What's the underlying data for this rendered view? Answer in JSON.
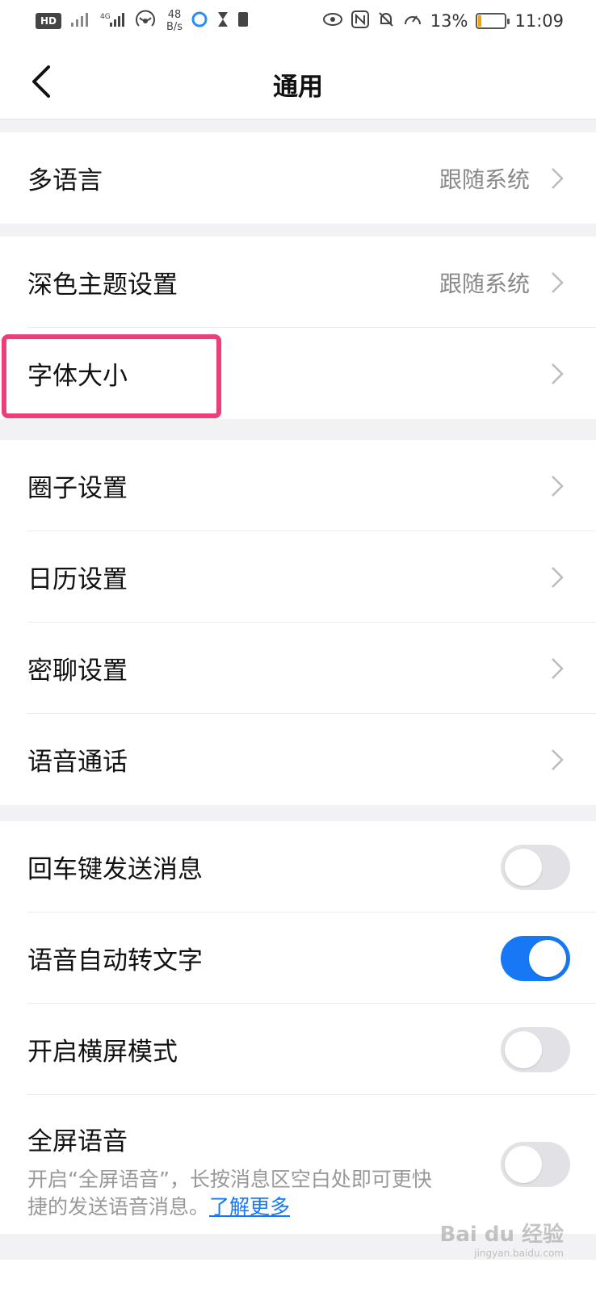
{
  "status_bar": {
    "hd_label": "HD",
    "network_speed": "48\nB/s",
    "battery_percent": "13%",
    "battery_level": 0.13,
    "time": "11:09"
  },
  "navbar": {
    "back_icon": "chevron-left-icon",
    "title": "通用"
  },
  "sections": {
    "language": {
      "label": "多语言",
      "value": "跟随系统"
    },
    "dark_theme": {
      "label": "深色主题设置",
      "value": "跟随系统"
    },
    "font_size": {
      "label": "字体大小"
    },
    "circle_settings": {
      "label": "圈子设置"
    },
    "calendar_settings": {
      "label": "日历设置"
    },
    "secret_chat_settings": {
      "label": "密聊设置"
    },
    "voice_call": {
      "label": "语音通话"
    },
    "enter_to_send": {
      "label": "回车键发送消息",
      "enabled": false
    },
    "voice_to_text": {
      "label": "语音自动转文字",
      "enabled": true
    },
    "landscape_mode": {
      "label": "开启横屏模式",
      "enabled": false
    },
    "fullscreen_voice": {
      "label": "全屏语音",
      "description": "开启“全屏语音”，长按消息区空白处即可更快捷的发送语音消息。",
      "link_text": "了解更多",
      "enabled": false
    }
  },
  "colors": {
    "accent": "#1678f5",
    "highlight_box": "#ec3f7a",
    "background": "#f2f2f5"
  },
  "watermark": {
    "brand": "Bai du 经验",
    "url": "jingyan.baidu.com"
  }
}
